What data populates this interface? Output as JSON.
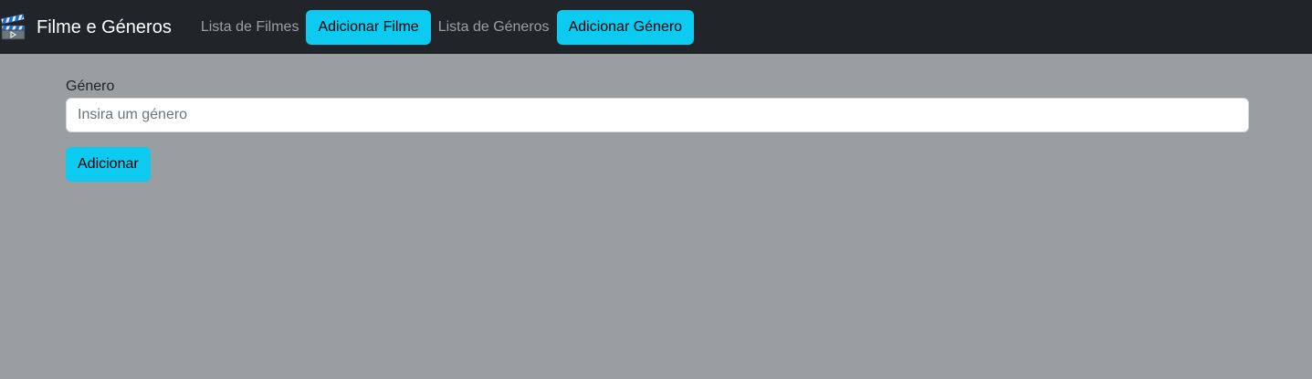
{
  "navbar": {
    "brand_icon": "clapperboard-icon",
    "brand_title": "Filme e Géneros",
    "links": [
      {
        "label": "Lista de Filmes",
        "type": "link"
      },
      {
        "label": "Adicionar Filme",
        "type": "button"
      },
      {
        "label": "Lista de Géneros",
        "type": "link"
      },
      {
        "label": "Adicionar Género",
        "type": "button"
      }
    ]
  },
  "form": {
    "label": "Género",
    "placeholder": "Insira um género",
    "value": "",
    "submit_label": "Adicionar"
  },
  "colors": {
    "navbar_bg": "#212529",
    "page_bg": "#9a9ea1",
    "accent": "#0dcaf0"
  }
}
